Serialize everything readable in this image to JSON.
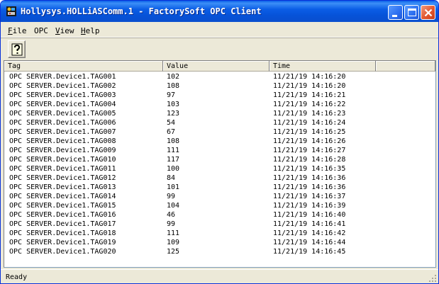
{
  "window": {
    "title": "Hollysys.HOLLiASComm.1 - FactorySoft OPC Client",
    "app_icon": "opc-app-icon",
    "buttons": [
      "minimize-icon",
      "maximize-icon",
      "close-icon"
    ]
  },
  "menu": {
    "items": [
      {
        "label": "File",
        "accel": "F"
      },
      {
        "label": "OPC",
        "accel": ""
      },
      {
        "label": "View",
        "accel": "V"
      },
      {
        "label": "Help",
        "accel": "H"
      }
    ]
  },
  "toolbar": {
    "help_icon": "help-question-icon"
  },
  "table": {
    "columns": [
      "Tag",
      "Value",
      "Time"
    ],
    "rows": [
      {
        "tag": "OPC SERVER.Device1.TAG001",
        "value": "102",
        "time": "11/21/19 14:16:20"
      },
      {
        "tag": "OPC SERVER.Device1.TAG002",
        "value": "108",
        "time": "11/21/19 14:16:20"
      },
      {
        "tag": "OPC SERVER.Device1.TAG003",
        "value": "97",
        "time": "11/21/19 14:16:21"
      },
      {
        "tag": "OPC SERVER.Device1.TAG004",
        "value": "103",
        "time": "11/21/19 14:16:22"
      },
      {
        "tag": "OPC SERVER.Device1.TAG005",
        "value": "123",
        "time": "11/21/19 14:16:23"
      },
      {
        "tag": "OPC SERVER.Device1.TAG006",
        "value": "54",
        "time": "11/21/19 14:16:24"
      },
      {
        "tag": "OPC SERVER.Device1.TAG007",
        "value": "67",
        "time": "11/21/19 14:16:25"
      },
      {
        "tag": "OPC SERVER.Device1.TAG008",
        "value": "108",
        "time": "11/21/19 14:16:26"
      },
      {
        "tag": "OPC SERVER.Device1.TAG009",
        "value": "111",
        "time": "11/21/19 14:16:27"
      },
      {
        "tag": "OPC SERVER.Device1.TAG010",
        "value": "117",
        "time": "11/21/19 14:16:28"
      },
      {
        "tag": "OPC SERVER.Device1.TAG011",
        "value": "100",
        "time": "11/21/19 14:16:35"
      },
      {
        "tag": "OPC SERVER.Device1.TAG012",
        "value": "84",
        "time": "11/21/19 14:16:36"
      },
      {
        "tag": "OPC SERVER.Device1.TAG013",
        "value": "101",
        "time": "11/21/19 14:16:36"
      },
      {
        "tag": "OPC SERVER.Device1.TAG014",
        "value": "99",
        "time": "11/21/19 14:16:37"
      },
      {
        "tag": "OPC SERVER.Device1.TAG015",
        "value": "104",
        "time": "11/21/19 14:16:39"
      },
      {
        "tag": "OPC SERVER.Device1.TAG016",
        "value": "46",
        "time": "11/21/19 14:16:40"
      },
      {
        "tag": "OPC SERVER.Device1.TAG017",
        "value": "99",
        "time": "11/21/19 14:16:41"
      },
      {
        "tag": "OPC SERVER.Device1.TAG018",
        "value": "111",
        "time": "11/21/19 14:16:42"
      },
      {
        "tag": "OPC SERVER.Device1.TAG019",
        "value": "109",
        "time": "11/21/19 14:16:44"
      },
      {
        "tag": "OPC SERVER.Device1.TAG020",
        "value": "125",
        "time": "11/21/19 14:16:45"
      }
    ]
  },
  "status": {
    "text": "Ready"
  },
  "colors": {
    "titlebar": "#0a5fe8",
    "chrome": "#ece9d8",
    "close_button": "#e2562e"
  }
}
